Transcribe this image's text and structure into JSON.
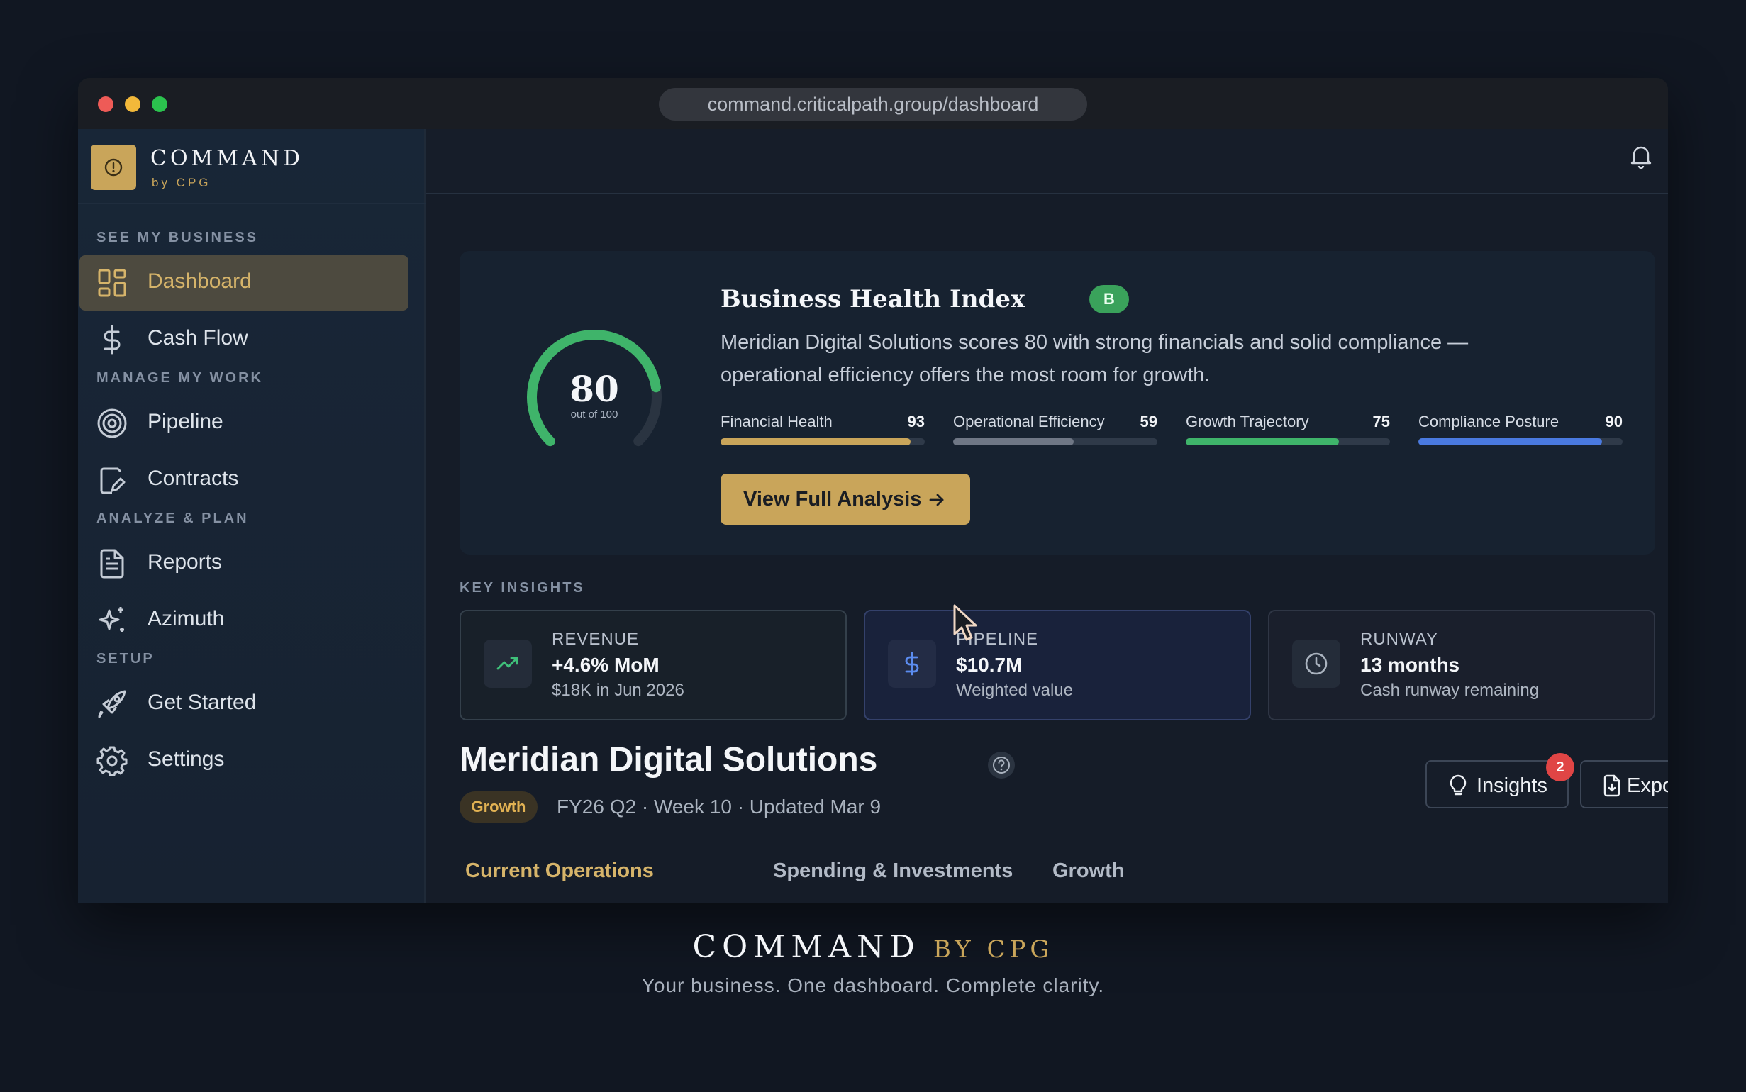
{
  "browser": {
    "url": "command.criticalpath.group/dashboard"
  },
  "brand": {
    "name": "COMMAND",
    "sub": "by CPG"
  },
  "sidebar": {
    "sections": [
      {
        "label": "SEE MY BUSINESS"
      },
      {
        "label": "MANAGE MY WORK"
      },
      {
        "label": "ANALYZE & PLAN"
      },
      {
        "label": "SETUP"
      }
    ],
    "items": [
      {
        "label": "Dashboard",
        "icon": "dashboard-icon",
        "active": true
      },
      {
        "label": "Cash Flow",
        "icon": "dollar-icon"
      },
      {
        "label": "Pipeline",
        "icon": "target-icon"
      },
      {
        "label": "Contracts",
        "icon": "contract-edit-icon"
      },
      {
        "label": "Reports",
        "icon": "report-icon"
      },
      {
        "label": "Azimuth",
        "icon": "sparkle-icon"
      },
      {
        "label": "Get Started",
        "icon": "rocket-icon"
      },
      {
        "label": "Settings",
        "icon": "gear-icon"
      }
    ]
  },
  "health": {
    "title": "Business Health Index",
    "grade": "B",
    "score": "80",
    "score_value": 80,
    "score_sub": "out of 100",
    "description": "Meridian Digital Solutions scores 80 with strong financials and solid compliance — operational efficiency offers the most room for growth.",
    "metrics": [
      {
        "label": "Financial Health",
        "value": "93",
        "pct": 93,
        "color": "#c9a55a"
      },
      {
        "label": "Operational Efficiency",
        "value": "59",
        "pct": 59,
        "color": "#6f7785"
      },
      {
        "label": "Growth Trajectory",
        "value": "75",
        "pct": 75,
        "color": "#3fb46a"
      },
      {
        "label": "Compliance Posture",
        "value": "90",
        "pct": 90,
        "color": "#4a7ae0"
      }
    ],
    "cta": "View Full Analysis"
  },
  "insights": {
    "label": "KEY INSIGHTS",
    "cards": [
      {
        "title": "REVENUE",
        "value": "+4.6% MoM",
        "sub": "$18K in Jun 2026",
        "icon": "trend-up-icon"
      },
      {
        "title": "PIPELINE",
        "value": "$10.7M",
        "sub": "Weighted value",
        "icon": "dollar-icon"
      },
      {
        "title": "RUNWAY",
        "value": "13 months",
        "sub": "Cash runway remaining",
        "icon": "clock-icon"
      }
    ]
  },
  "company": {
    "name": "Meridian Digital Solutions",
    "tag": "Growth",
    "period": "FY26 Q2 · Week 10  ·  Updated Mar 9"
  },
  "actions": {
    "insights": "Insights",
    "insights_count": "2",
    "export": "Export"
  },
  "tabs": [
    "Current Operations",
    "Spending & Investments",
    "Growth"
  ],
  "footer": {
    "brand": "COMMAND",
    "by": "BY CPG",
    "tagline": "Your business. One dashboard. Complete clarity."
  }
}
